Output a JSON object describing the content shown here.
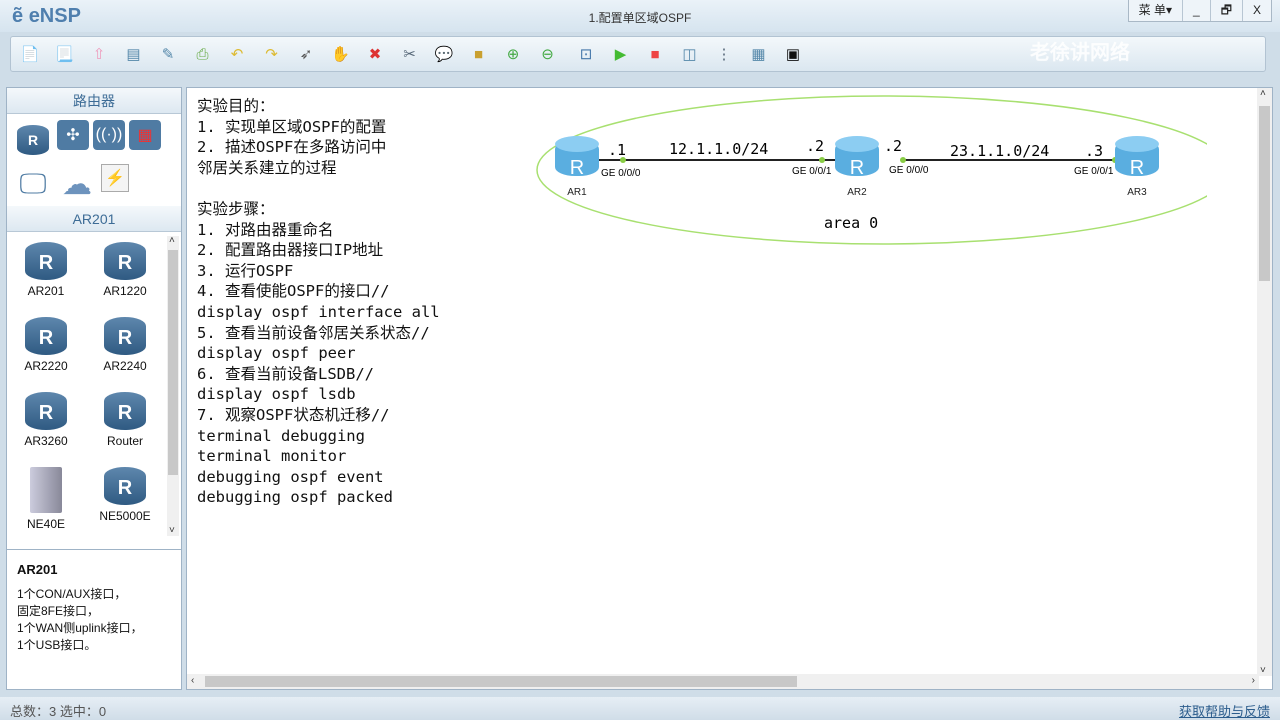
{
  "app": {
    "name": "eNSP",
    "window_title": "1.配置单区域OSPF",
    "menu_label": "菜 单▾",
    "min": "_",
    "restore": "🗗",
    "close": "X",
    "watermark": "老徐讲网络"
  },
  "toolbar": [
    {
      "name": "new-topology",
      "glyph": "📄",
      "color": "#6b8"
    },
    {
      "name": "new-template",
      "glyph": "📃",
      "color": "#6b8"
    },
    {
      "name": "open",
      "glyph": "⇧",
      "color": "#e9b"
    },
    {
      "name": "save",
      "glyph": "▤",
      "color": "#58a"
    },
    {
      "name": "save-as",
      "glyph": "✎",
      "color": "#58a"
    },
    {
      "name": "print",
      "glyph": "⎙",
      "color": "#6a4"
    },
    {
      "name": "undo",
      "glyph": "↶",
      "color": "#db3"
    },
    {
      "name": "redo",
      "glyph": "↷",
      "color": "#db3"
    },
    {
      "name": "select",
      "glyph": "➶",
      "color": "#555"
    },
    {
      "name": "hand",
      "glyph": "✋",
      "color": "#d93"
    },
    {
      "name": "delete",
      "glyph": "✖",
      "color": "#d33"
    },
    {
      "name": "delete-link",
      "glyph": "✂",
      "color": "#567"
    },
    {
      "name": "text",
      "glyph": "💬",
      "color": "#6a4"
    },
    {
      "name": "palette",
      "glyph": "■",
      "color": "#c9a030"
    },
    {
      "name": "zoom-in",
      "glyph": "⊕",
      "color": "#4a4"
    },
    {
      "name": "zoom-out",
      "glyph": "⊖",
      "color": "#4a4"
    },
    {
      "name": "fit",
      "glyph": "⊡",
      "color": "#47a"
    },
    {
      "name": "start",
      "glyph": "▶",
      "color": "#4b3"
    },
    {
      "name": "stop",
      "glyph": "■",
      "color": "#e44"
    },
    {
      "name": "capture",
      "glyph": "◫",
      "color": "#58a"
    },
    {
      "name": "topology",
      "glyph": "⋮",
      "color": "#567"
    },
    {
      "name": "grid",
      "glyph": "▦",
      "color": "#58a"
    },
    {
      "name": "cli",
      "glyph": "▣",
      "color": "#111"
    }
  ],
  "left": {
    "category_title": "路由器",
    "sub_title": "AR201",
    "devices": [
      "AR201",
      "AR1220",
      "AR2220",
      "AR2240",
      "AR3260",
      "Router",
      "NE40E",
      "NE5000E"
    ],
    "info_title": "AR201",
    "info_lines": [
      "1个CON/AUX接口，",
      "固定8FE接口，",
      "1个WAN侧uplink接口，",
      "1个USB接口。"
    ]
  },
  "notes": [
    "实验目的：",
    "1. 实现单区域OSPF的配置",
    "2. 描述OSPF在多路访问中",
    "邻居关系建立的过程",
    "",
    "实验步骤：",
    "1. 对路由器重命名",
    "2. 配置路由器接口IP地址",
    "3. 运行OSPF",
    "4. 查看使能OSPF的接口//",
    "display ospf interface all",
    "5. 查看当前设备邻居关系状态//",
    "display ospf peer",
    "6. 查看当前设备LSDB//",
    "display ospf lsdb",
    "7. 观察OSPF状态机迁移//",
    "terminal debugging",
    "terminal monitor",
    "debugging ospf event",
    "debugging ospf packed"
  ],
  "topology": {
    "area": "area 0",
    "routers": [
      "AR1",
      "AR2",
      "AR3"
    ],
    "links": [
      {
        "net": "12.1.1.0/24",
        "a_ip": ".1",
        "a_if": "GE 0/0/0",
        "b_ip": ".2",
        "b_if": "GE 0/0/1"
      },
      {
        "net": "23.1.1.0/24",
        "a_ip": ".2",
        "a_if": "GE 0/0/0",
        "b_ip": ".3",
        "b_if": "GE 0/0/1"
      }
    ]
  },
  "status": {
    "left": "总数：3  选中：0",
    "help": "获取帮助与反馈"
  }
}
